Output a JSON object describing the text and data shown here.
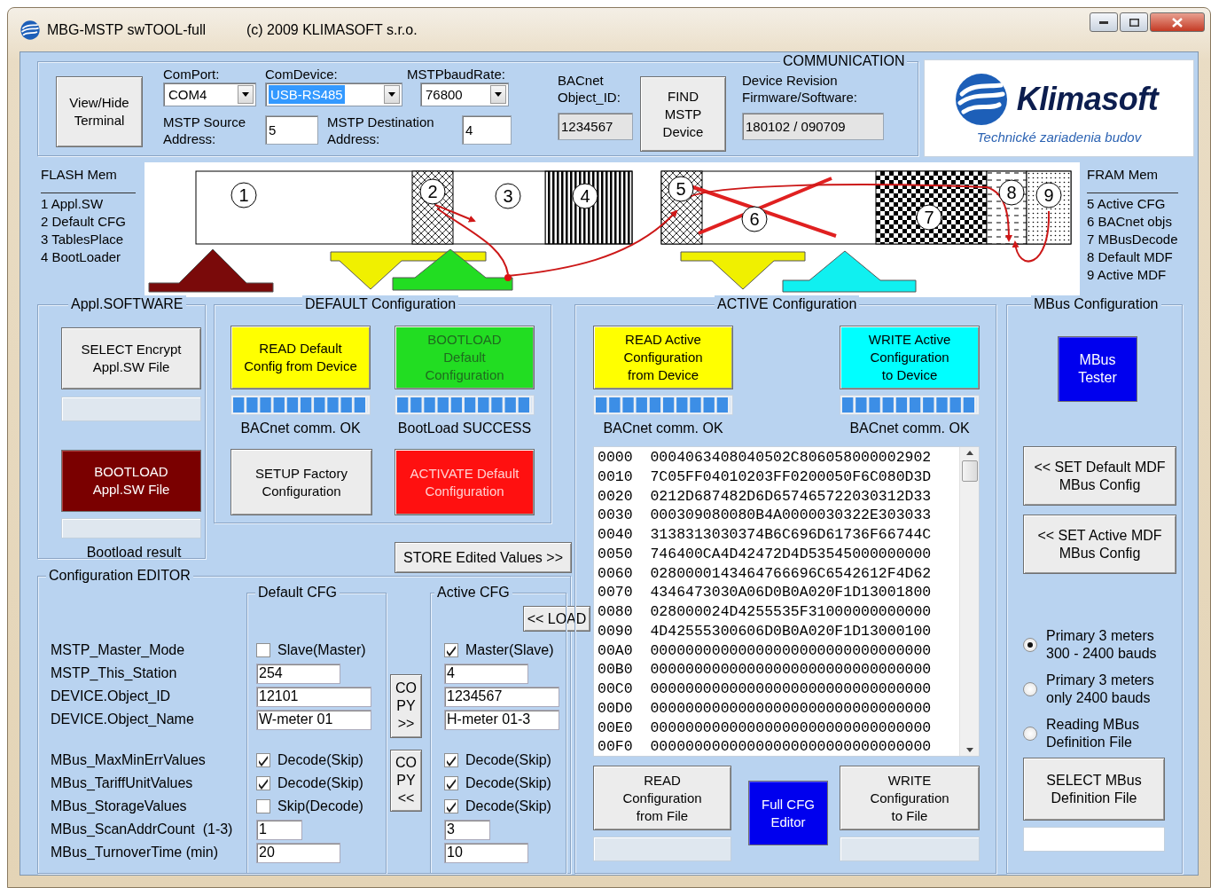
{
  "window": {
    "title": "MBG-MSTP swTOOL-full",
    "copyright": "(c) 2009 KLIMASOFT s.r.o."
  },
  "communication": {
    "legend": "COMMUNICATION",
    "view_hide_button": "View/Hide\nTerminal",
    "comport": {
      "label": "ComPort:",
      "value": "COM4",
      "highlighted": false
    },
    "comdevice": {
      "label": "ComDevice:",
      "value": "USB-RS485",
      "highlighted": true
    },
    "baudrate": {
      "label": "MSTPbaudRate:",
      "value": "76800",
      "highlighted": false
    },
    "source_address": {
      "label": "MSTP Source\nAddress:",
      "value": "5"
    },
    "destination_address": {
      "label": "MSTP Destination\nAddress:",
      "value": "4"
    },
    "bacnet_object_id": {
      "label": "BACnet\nObject_ID:",
      "value": "1234567"
    },
    "find_button": "FIND\nMSTP\nDevice",
    "device_revision": {
      "label": "Device Revision\nFirmware/Software:",
      "value": "180102 / 090709"
    }
  },
  "logo": {
    "name": "Klimasoft",
    "tagline": "Technické zariadenia budov"
  },
  "memory": {
    "flash_title": "FLASH Mem",
    "flash_items": [
      "1 Appl.SW",
      "2 Default CFG",
      "3 TablesPlace",
      "4 BootLoader"
    ],
    "fram_title": "FRAM Mem",
    "fram_items": [
      "5 Active CFG",
      "6 BACnet objs",
      "7 MBusDecode",
      "8 Default MDF",
      "9 Active MDF"
    ],
    "blocks": [
      "1",
      "2",
      "3",
      "4",
      "5",
      "6",
      "7",
      "8",
      "9"
    ]
  },
  "appl_software": {
    "legend": "Appl.SOFTWARE",
    "select_button": "SELECT Encrypt\nAppl.SW File",
    "bootload_button": "BOOTLOAD\nAppl.SW File",
    "result_caption": "Bootload result"
  },
  "default_config": {
    "legend": "DEFAULT Configuration",
    "read_button": "READ Default\nConfig from Device",
    "read_progress": {
      "level": 1
    },
    "read_status": "BACnet comm. OK",
    "bootload_button": "BOOTLOAD\nDefault\nConfiguration",
    "bootload_progress": {
      "level": 1
    },
    "bootload_status": "BootLoad SUCCESS",
    "setup_button": "SETUP Factory\nConfiguration",
    "activate_button": "ACTIVATE Default\nConfiguration"
  },
  "store_button": "STORE Edited Values >>",
  "active_config": {
    "legend": "ACTIVE Configuration",
    "read_button": "READ Active\nConfiguration\nfrom Device",
    "read_progress": {
      "level": 1
    },
    "read_status": "BACnet comm. OK",
    "write_button": "WRITE Active\nConfiguration\nto Device",
    "write_progress": {
      "level": 1
    },
    "write_status": "BACnet comm. OK",
    "hex_rows": [
      {
        "address": "0000",
        "data": "0004063408040502C806058000002902"
      },
      {
        "address": "0010",
        "data": "7C05FF04010203FF0200050F6C080D3D"
      },
      {
        "address": "0020",
        "data": "0212D687482D6D657465722030312D33"
      },
      {
        "address": "0030",
        "data": "000309080080B4A0000030322E303033"
      },
      {
        "address": "0040",
        "data": "3138313030374B6C696D61736F66744C"
      },
      {
        "address": "0050",
        "data": "746400CA4D42472D4D53545000000000"
      },
      {
        "address": "0060",
        "data": "0280000143464766696C6542612F4D62"
      },
      {
        "address": "0070",
        "data": "4346473030A06D0B0A020F1D13001800"
      },
      {
        "address": "0080",
        "data": "028000024D4255535F31000000000000"
      },
      {
        "address": "0090",
        "data": "4D42555300606D0B0A020F1D13000100"
      },
      {
        "address": "00A0",
        "data": "00000000000000000000000000000000"
      },
      {
        "address": "00B0",
        "data": "00000000000000000000000000000000"
      },
      {
        "address": "00C0",
        "data": "00000000000000000000000000000000"
      },
      {
        "address": "00D0",
        "data": "00000000000000000000000000000000"
      },
      {
        "address": "00E0",
        "data": "00000000000000000000000000000000"
      },
      {
        "address": "00F0",
        "data": "00000000000000000000000000000000"
      }
    ],
    "read_file_button": "READ\nConfiguration\nfrom File",
    "full_editor_button": "Full CFG\nEditor",
    "write_file_button": "WRITE\nConfiguration\nto File"
  },
  "mbus_config": {
    "legend": "MBus Configuration",
    "tester_button": "MBus\nTester",
    "set_default_button": "<< SET Default MDF\nMBus Config",
    "set_active_button": "<< SET Active MDF\nMBus Config",
    "radios": [
      {
        "label": "Primary 3 meters\n300 - 2400 bauds",
        "selected": true
      },
      {
        "label": "Primary 3 meters\nonly 2400 bauds",
        "selected": false
      },
      {
        "label": "Reading MBus\nDefinition File",
        "selected": false
      }
    ],
    "select_button": "SELECT MBus\nDefinition File"
  },
  "editor": {
    "legend": "Configuration EDITOR",
    "default_legend": "Default CFG",
    "active_legend": "Active CFG",
    "load_button": "<< LOAD",
    "copy_forward_button": "CO\nPY\n>>",
    "copy_back_button": "CO\nPY\n<<",
    "device_rows": [
      {
        "label": "MSTP_Master_Mode",
        "kind": "checkbox",
        "default": {
          "checked": false,
          "text": "Slave(Master)"
        },
        "active": {
          "checked": true,
          "text": "Master(Slave)"
        }
      },
      {
        "label": "MSTP_This_Station",
        "kind": "field",
        "default": {
          "value": "254"
        },
        "active": {
          "value": "4"
        }
      },
      {
        "label": "DEVICE.Object_ID",
        "kind": "field",
        "default": {
          "value": "12101"
        },
        "active": {
          "value": "1234567"
        }
      },
      {
        "label": "DEVICE.Object_Name",
        "kind": "field",
        "default": {
          "value": "W-meter 01"
        },
        "active": {
          "value": "H-meter 01-3"
        }
      }
    ],
    "mbus_rows": [
      {
        "label": "MBus_MaxMinErrValues",
        "kind": "checkbox",
        "default": {
          "checked": true,
          "text": "Decode(Skip)"
        },
        "active": {
          "checked": true,
          "text": "Decode(Skip)"
        }
      },
      {
        "label": "MBus_TariffUnitValues",
        "kind": "checkbox",
        "default": {
          "checked": true,
          "text": "Decode(Skip)"
        },
        "active": {
          "checked": true,
          "text": "Decode(Skip)"
        }
      },
      {
        "label": "MBus_StorageValues",
        "kind": "checkbox",
        "default": {
          "checked": false,
          "text": "Skip(Decode)"
        },
        "active": {
          "checked": true,
          "text": "Decode(Skip)"
        }
      },
      {
        "label": "MBus_ScanAddrCount  (1-3)",
        "kind": "field",
        "default": {
          "value": "1"
        },
        "active": {
          "value": "3"
        }
      },
      {
        "label": "MBus_TurnoverTime (min)",
        "kind": "field",
        "default": {
          "value": "20"
        },
        "active": {
          "value": "10"
        }
      }
    ]
  }
}
